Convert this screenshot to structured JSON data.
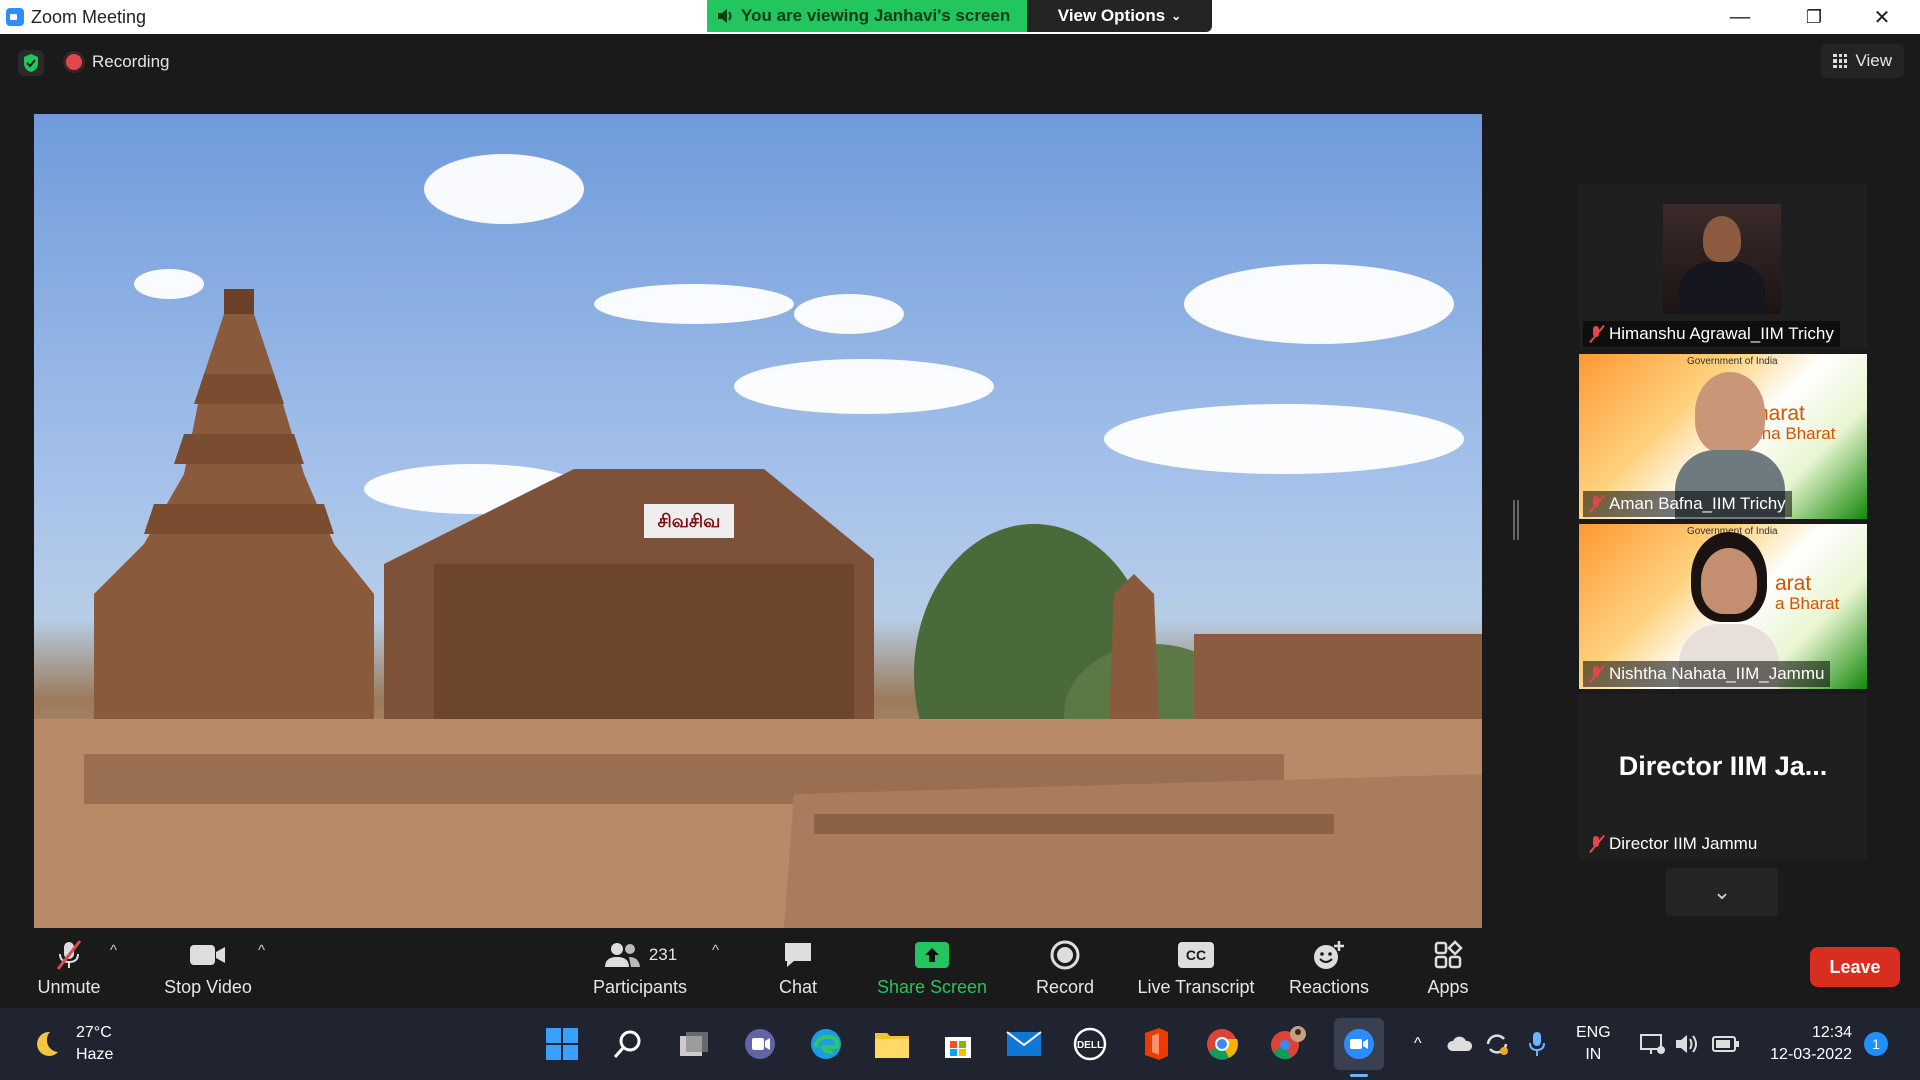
{
  "window": {
    "title": "Zoom Meeting",
    "minimize": "—",
    "restore": "❐",
    "close": "✕"
  },
  "share_banner": {
    "text": "You are viewing Janhavi's screen",
    "view_options": "View Options"
  },
  "topbar": {
    "recording_label": "Recording",
    "view_label": "View"
  },
  "shared_content": {
    "sign_text": "சிவசிவ"
  },
  "participants_panel": [
    {
      "name": "Himanshu Agrawal_IIM Trichy",
      "muted": true
    },
    {
      "name": "Aman Bafna_IIM Trichy",
      "muted": true,
      "banner_top": "Government of India",
      "banner_line1": "harat",
      "banner_line2": "tha Bharat"
    },
    {
      "name": "Nishtha Nahata_IIM_Jammu",
      "muted": true,
      "banner_top": "Government of India",
      "banner_line1": "arat",
      "banner_line2": "a Bharat"
    },
    {
      "name": "Director IIM Jammu",
      "display_name": "Director  IIM  Ja...",
      "muted": true
    }
  ],
  "toolbar": {
    "unmute": "Unmute",
    "stop_video": "Stop Video",
    "participants": "Participants",
    "participant_count": "231",
    "chat": "Chat",
    "share_screen": "Share Screen",
    "record": "Record",
    "live_transcript": "Live Transcript",
    "cc": "CC",
    "reactions": "Reactions",
    "apps": "Apps",
    "leave": "Leave"
  },
  "taskbar": {
    "temperature": "27°C",
    "weather": "Haze",
    "language_line1": "ENG",
    "language_line2": "IN",
    "time": "12:34",
    "date": "12-03-2022",
    "notification_count": "1",
    "dell_label": "DELL"
  },
  "colors": {
    "share_green": "#22c55e",
    "leave_red": "#d92d20",
    "zoom_blue": "#2d8cff",
    "muted_red": "#e0484c"
  }
}
